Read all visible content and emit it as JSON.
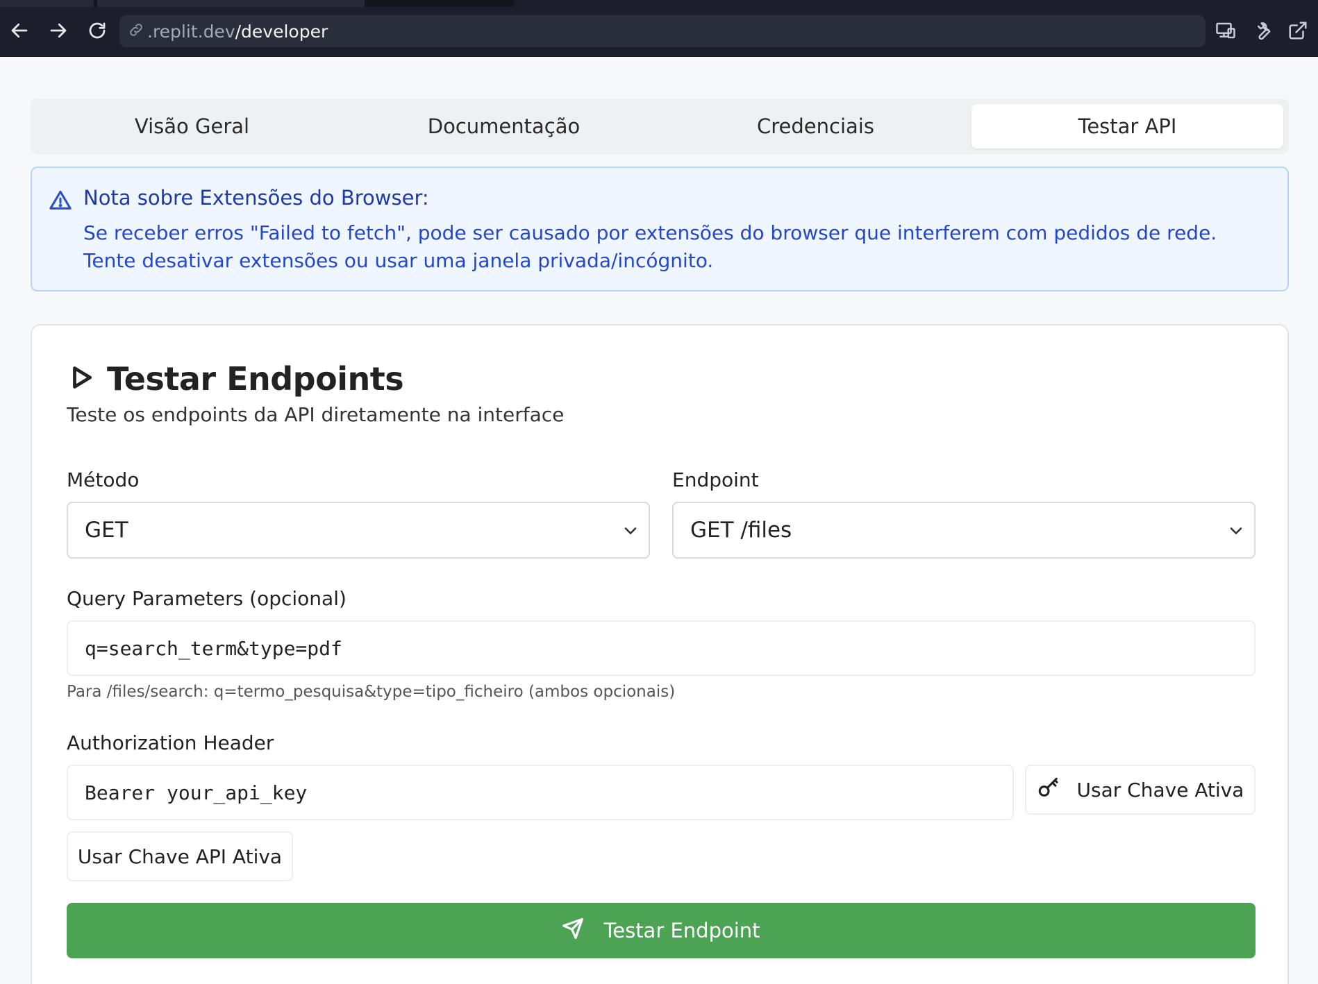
{
  "browser": {
    "url_prefix": ".replit.dev",
    "url_path": "/developer",
    "icons": [
      "back-arrow-icon",
      "forward-arrow-icon",
      "reload-icon",
      "link-icon",
      "devices-icon",
      "wrench-icon",
      "external-link-icon"
    ]
  },
  "tabs": [
    {
      "label": "Visão Geral",
      "active": false
    },
    {
      "label": "Documentação",
      "active": false
    },
    {
      "label": "Credenciais",
      "active": false
    },
    {
      "label": "Testar API",
      "active": true
    }
  ],
  "alert": {
    "icon": "warning-triangle-icon",
    "title": "Nota sobre Extensões do Browser:",
    "body": "Se receber erros \"Failed to fetch\", pode ser causado por extensões do browser que interferem com pedidos de rede. Tente desativar extensões ou usar uma janela privada/incógnito.",
    "color": "#2447c8"
  },
  "card": {
    "icon": "play-icon",
    "title": "Testar Endpoints",
    "subtitle": "Teste os endpoints da API diretamente na interface",
    "method": {
      "label": "Método",
      "value": "GET"
    },
    "endpoint": {
      "label": "Endpoint",
      "value": "GET /files"
    },
    "query": {
      "label": "Query Parameters (opcional)",
      "value": "q=search_term&type=pdf",
      "hint": "Para /files/search: q=termo_pesquisa&type=tipo_ficheiro (ambos opcionais)"
    },
    "auth": {
      "label": "Authorization Header",
      "value": "Bearer your_api_key",
      "use_active_key_label": "Usar Chave Ativa",
      "use_active_api_key_label": "Usar Chave API Ativa"
    },
    "submit_label": "Testar Endpoint",
    "accent_color": "#4ca354"
  }
}
